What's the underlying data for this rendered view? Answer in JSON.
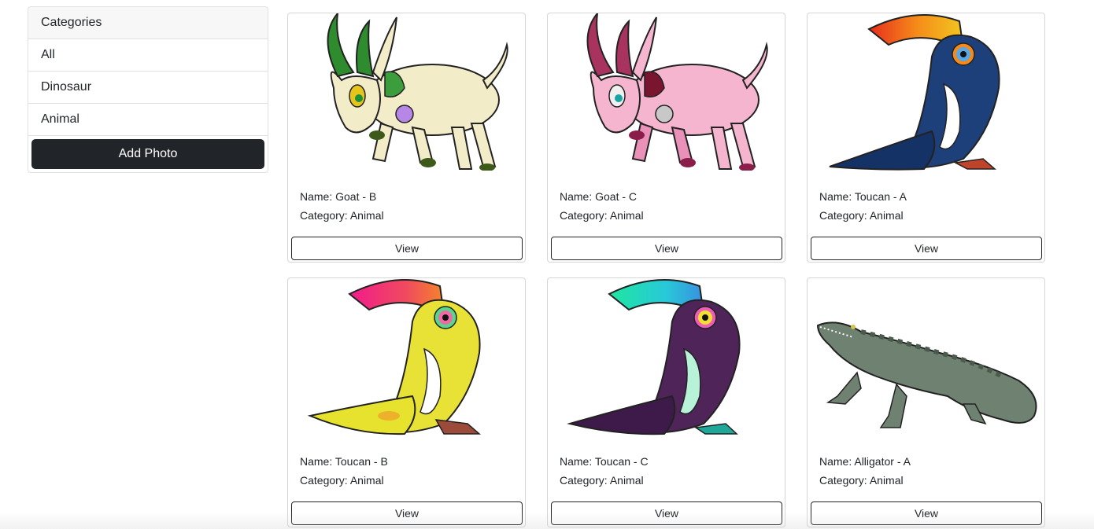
{
  "sidebar": {
    "header": "Categories",
    "items": [
      "All",
      "Dinosaur",
      "Animal"
    ],
    "add_button": "Add Photo"
  },
  "photos": [
    {
      "name": "Name: Goat - B",
      "category": "Category: Animal",
      "view": "View",
      "icon": "goat-cream-icon"
    },
    {
      "name": "Name: Goat - C",
      "category": "Category: Animal",
      "view": "View",
      "icon": "goat-pink-icon"
    },
    {
      "name": "Name: Toucan - A",
      "category": "Category: Animal",
      "view": "View",
      "icon": "toucan-blue-icon"
    },
    {
      "name": "Name: Toucan - B",
      "category": "Category: Animal",
      "view": "View",
      "icon": "toucan-yellow-icon"
    },
    {
      "name": "Name: Toucan - C",
      "category": "Category: Animal",
      "view": "View",
      "icon": "toucan-purple-icon"
    },
    {
      "name": "Name: Alligator - A",
      "category": "Category: Animal",
      "view": "View",
      "icon": "alligator-icon"
    }
  ]
}
